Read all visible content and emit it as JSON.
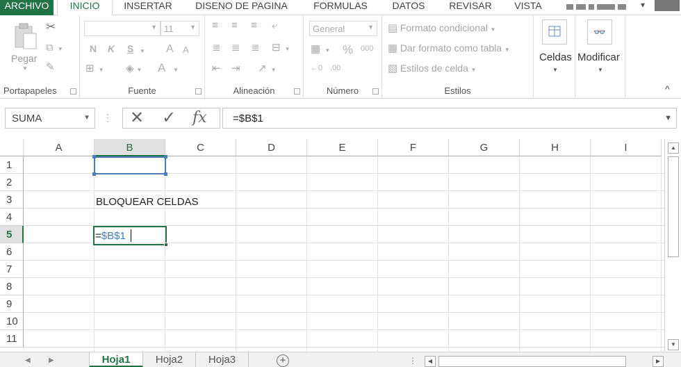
{
  "menu": {
    "file": "ARCHIVO",
    "tabs": [
      "INICIO",
      "INSERTAR",
      "DISENO DE PAGINA",
      "FORMULAS",
      "DATOS",
      "REVISAR",
      "VISTA"
    ],
    "active_tab": "INICIO",
    "user_caret": "▾"
  },
  "ribbon": {
    "clipboard": {
      "paste_label": "Pegar",
      "group_label": "Portapapeles"
    },
    "font": {
      "font_name": "",
      "font_size": "11",
      "bold": "N",
      "italic": "K",
      "underline": "S",
      "grow": "A",
      "shrink": "A",
      "font_color": "A",
      "group_label": "Fuente"
    },
    "alignment": {
      "group_label": "Alineación"
    },
    "number": {
      "format": "General",
      "percent": "%",
      "thousands": "000",
      "inc_decimals": "←0",
      "dec_decimals": ",00",
      "group_label": "Número"
    },
    "styles": {
      "conditional": "Formato condicional",
      "as_table": "Dar formato como tabla",
      "cell_styles": "Estilos de celda",
      "group_label": "Estilos"
    },
    "cells": {
      "label": "Celdas"
    },
    "editing": {
      "label": "Modificar"
    },
    "collapse": "^"
  },
  "formula_bar": {
    "name_box": "SUMA",
    "cancel": "✕",
    "enter": "✓",
    "fx": "fx",
    "formula": "=$B$1"
  },
  "grid": {
    "columns": [
      "A",
      "B",
      "C",
      "D",
      "E",
      "F",
      "G",
      "H",
      "I"
    ],
    "selected_column": "B",
    "rows": [
      "1",
      "2",
      "3",
      "4",
      "5",
      "6",
      "7",
      "8",
      "9",
      "10",
      "11"
    ],
    "selected_row": "5",
    "cells": {
      "B3": "BLOQUEAR CELDAS",
      "B5_prefix": "=",
      "B5_ref": "$B$1"
    }
  },
  "sheets": {
    "tabs": [
      "Hoja1",
      "Hoja2",
      "Hoja3"
    ],
    "active": "Hoja1",
    "add": "+"
  },
  "colors": {
    "accent": "#217346",
    "reference": "#4a7ebb"
  }
}
